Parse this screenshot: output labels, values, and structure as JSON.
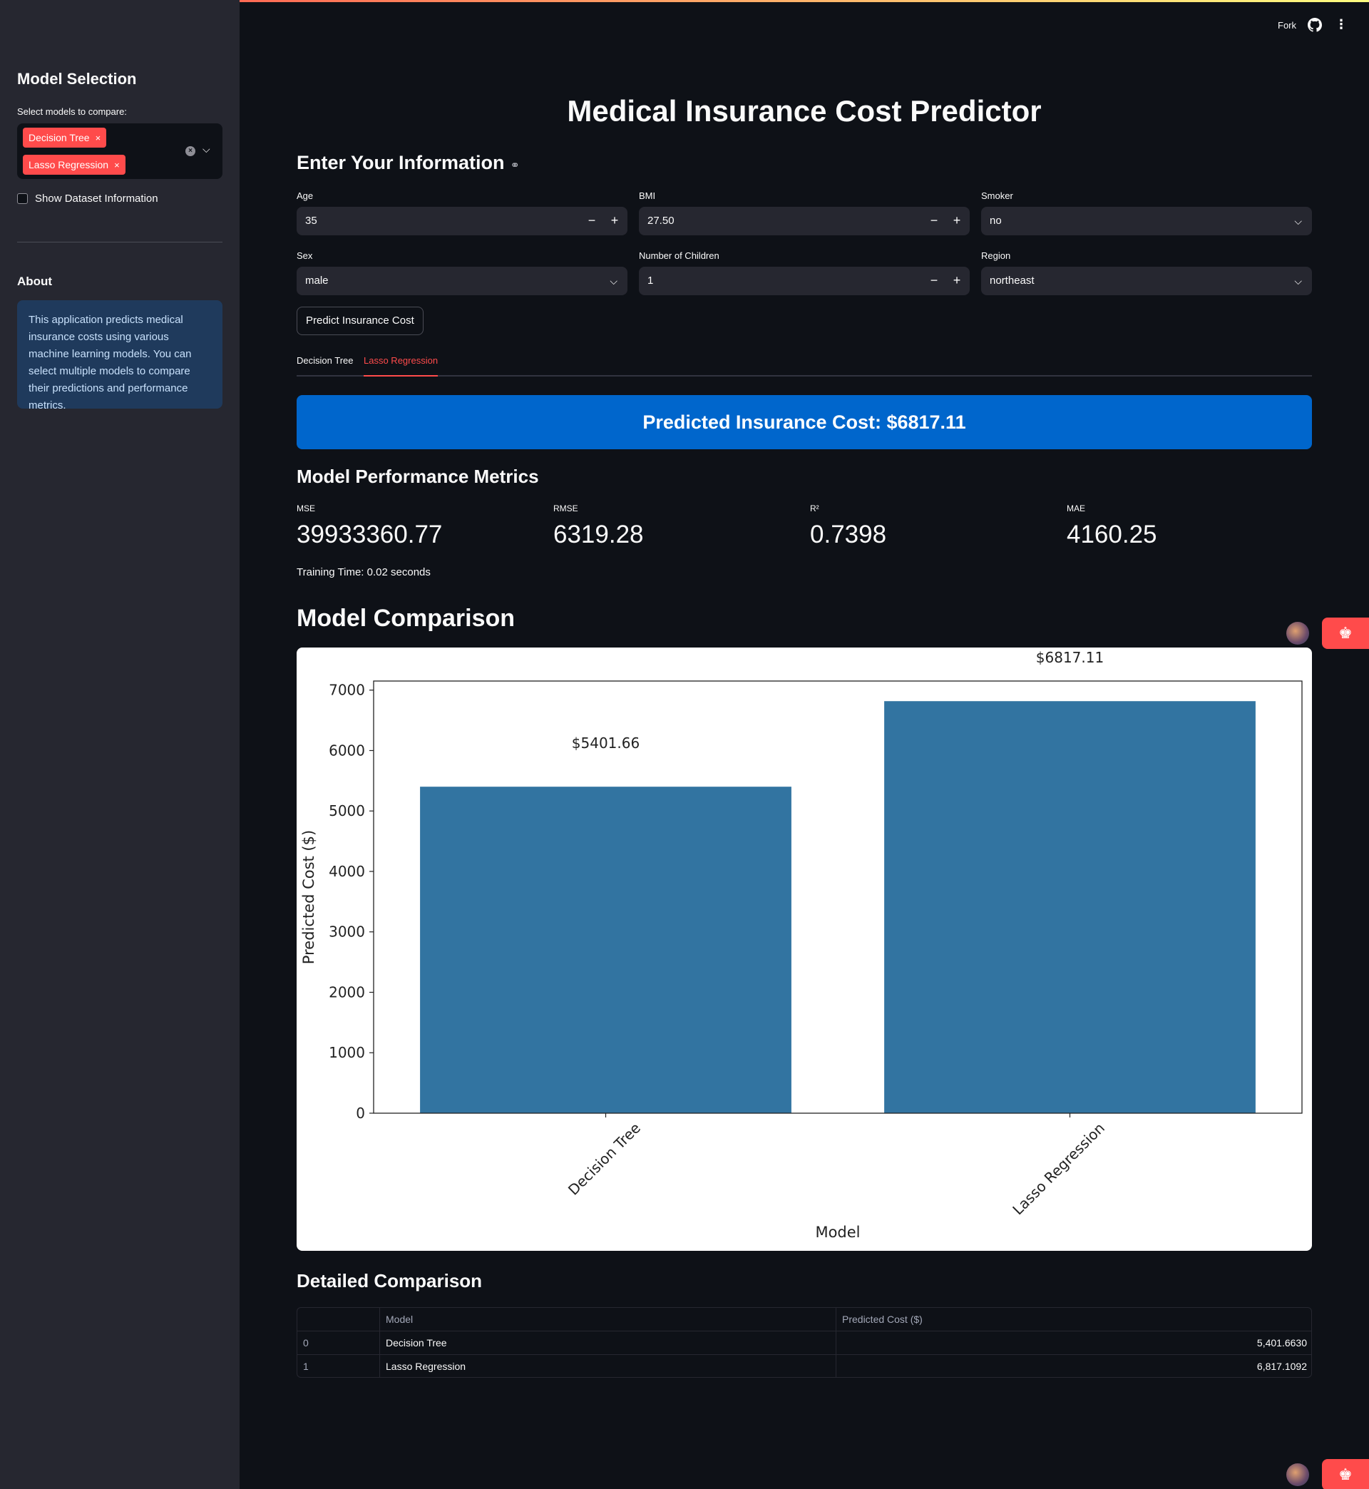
{
  "sidebar": {
    "title": "Model Selection",
    "select_label": "Select models to compare:",
    "selected_models": [
      "Decision Tree",
      "Lasso Regression"
    ],
    "chip_remove": "×",
    "checkbox_label": "Show Dataset Information",
    "about_title": "About",
    "about_text": "This application predicts medical insurance costs using various machine learning models. You can select multiple models to compare their predictions and performance metrics."
  },
  "toolbar": {
    "fork_label": "Fork"
  },
  "main": {
    "title": "Medical Insurance Cost Predictor",
    "input_section": "Enter Your Information",
    "fields": {
      "age": {
        "label": "Age",
        "value": "35"
      },
      "bmi": {
        "label": "BMI",
        "value": "27.50"
      },
      "smoker": {
        "label": "Smoker",
        "value": "no"
      },
      "sex": {
        "label": "Sex",
        "value": "male"
      },
      "children": {
        "label": "Number of Children",
        "value": "1"
      },
      "region": {
        "label": "Region",
        "value": "northeast"
      }
    },
    "stepper_minus": "−",
    "stepper_plus": "+",
    "predict_button": "Predict Insurance Cost",
    "tabs": [
      "Decision Tree",
      "Lasso Regression"
    ],
    "active_tab": "Lasso Regression",
    "prediction_banner": "Predicted Insurance Cost: $6817.11",
    "metrics_title": "Model Performance Metrics",
    "metrics": [
      {
        "label": "MSE",
        "value": "39933360.77"
      },
      {
        "label": "RMSE",
        "value": "6319.28"
      },
      {
        "label": "R²",
        "value": "0.7398"
      },
      {
        "label": "MAE",
        "value": "4160.25"
      }
    ],
    "training_time": "Training Time: 0.02 seconds",
    "comparison_title": "Model Comparison",
    "detailed_title": "Detailed Comparison",
    "table": {
      "columns": [
        "",
        "Model",
        "Predicted Cost ($)"
      ],
      "rows": [
        [
          "0",
          "Decision Tree",
          "5,401.6630"
        ],
        [
          "1",
          "Lasso Regression",
          "6,817.1092"
        ]
      ]
    }
  },
  "colors": {
    "accent": "#ff4b4b",
    "banner": "#0066cc",
    "bar": "#3274a1"
  },
  "icons": {
    "github": "github-icon",
    "menu": "kebab-menu-icon",
    "link": "link-icon",
    "crown": "crown-icon"
  },
  "chart_data": {
    "type": "bar",
    "categories": [
      "Decision Tree",
      "Lasso Regression"
    ],
    "values": [
      5401.66,
      6817.11
    ],
    "data_labels": [
      "$5401.66",
      "$6817.11"
    ],
    "xlabel": "Model",
    "ylabel": "Predicted Cost ($)",
    "ylim": [
      0,
      7150
    ],
    "yticks": [
      0,
      1000,
      2000,
      3000,
      4000,
      5000,
      6000,
      7000
    ],
    "grid": false
  }
}
